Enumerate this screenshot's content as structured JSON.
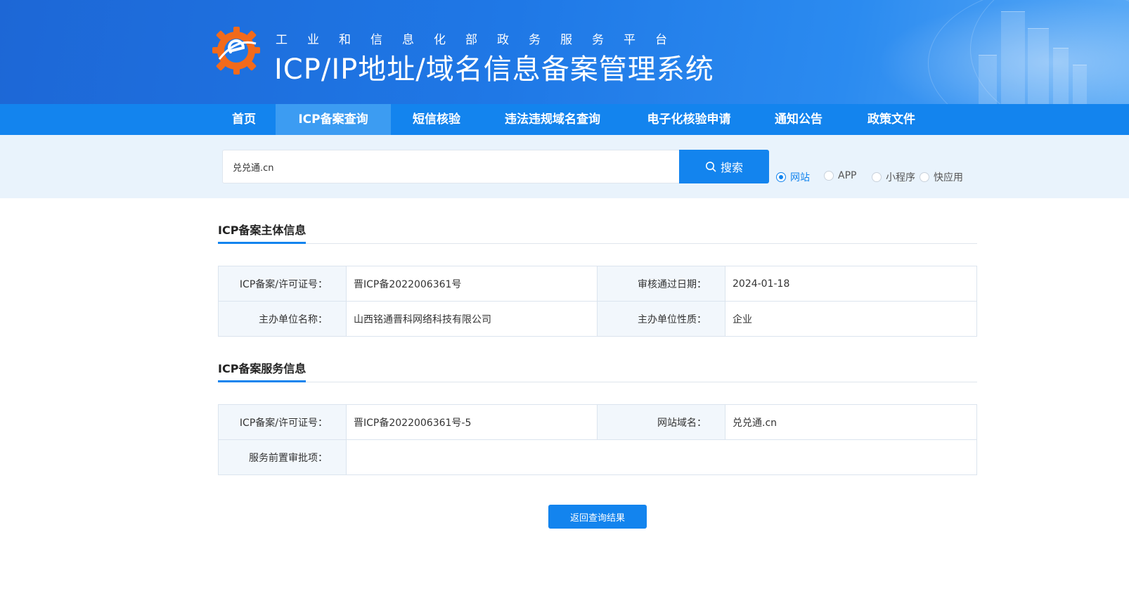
{
  "header": {
    "subtitle": "工业和信息化部政务服务平台",
    "title": "ICP/IP地址/域名信息备案管理系统"
  },
  "nav": {
    "items": [
      {
        "label": "首页"
      },
      {
        "label": "ICP备案查询"
      },
      {
        "label": "短信核验"
      },
      {
        "label": "违法违规域名查询"
      },
      {
        "label": "电子化核验申请"
      },
      {
        "label": "通知公告"
      },
      {
        "label": "政策文件"
      }
    ],
    "active": "ICP备案查询"
  },
  "search": {
    "value": "兑兑通.cn",
    "button_label": "搜索",
    "options": [
      "网站",
      "APP",
      "小程序",
      "快应用"
    ],
    "selected": "网站"
  },
  "subject_section": {
    "title": "ICP备案主体信息",
    "rows": [
      {
        "k1": "ICP备案/许可证号：",
        "v1": "晋ICP备2022006361号",
        "k2": "审核通过日期：",
        "v2": "2024-01-18"
      },
      {
        "k1": "主办单位名称：",
        "v1": "山西铭通晋科网络科技有限公司",
        "k2": "主办单位性质：",
        "v2": "企业"
      }
    ]
  },
  "service_section": {
    "title": "ICP备案服务信息",
    "rows": [
      {
        "k1": "ICP备案/许可证号：",
        "v1": "晋ICP备2022006361号-5",
        "k2": "网站域名：",
        "v2": "兑兑通.cn"
      }
    ],
    "approval_label": "服务前置审批项：",
    "approval_value": ""
  },
  "back_button_label": "返回查询结果",
  "colors": {
    "primary": "#1384ee",
    "nav_active": "#3c9cf2",
    "search_strip": "#e9f3fc",
    "key_cell": "#f2f7fc"
  }
}
